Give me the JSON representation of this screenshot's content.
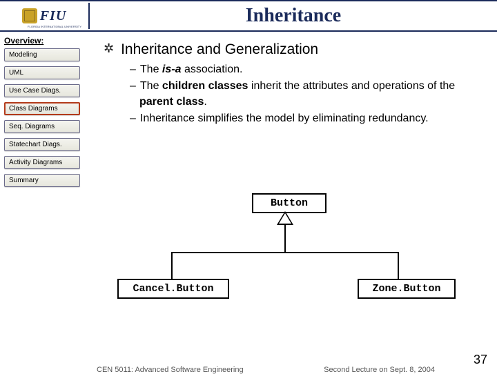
{
  "header": {
    "logo_text": "FIU",
    "logo_sub": "FLORIDA INTERNATIONAL UNIVERSITY",
    "title": "Inheritance"
  },
  "sidebar": {
    "label": "Overview:",
    "items": [
      {
        "label": "Modeling"
      },
      {
        "label": "UML"
      },
      {
        "label": "Use Case Diags."
      },
      {
        "label": "Class Diagrams"
      },
      {
        "label": "Seq. Diagrams"
      },
      {
        "label": "Statechart Diags."
      },
      {
        "label": "Activity Diagrams"
      },
      {
        "label": "Summary"
      }
    ],
    "active_index": 3
  },
  "content": {
    "heading": "Inheritance and Generalization",
    "points": [
      {
        "pre": "The ",
        "bold": "is-a",
        "post": " association."
      },
      {
        "pre": "The ",
        "bold": "children classes",
        "mid": " inherit the attributes and operations of the ",
        "bold2": "parent class",
        "post": "."
      },
      {
        "pre": "Inheritance simplifies the model by eliminating redundancy."
      }
    ]
  },
  "diagram": {
    "parent": "Button",
    "child_left": "Cancel.Button",
    "child_right": "Zone.Button"
  },
  "footer": {
    "left": "CEN 5011: Advanced Software Engineering",
    "right": "Second Lecture on Sept. 8, 2004",
    "page": "37"
  }
}
